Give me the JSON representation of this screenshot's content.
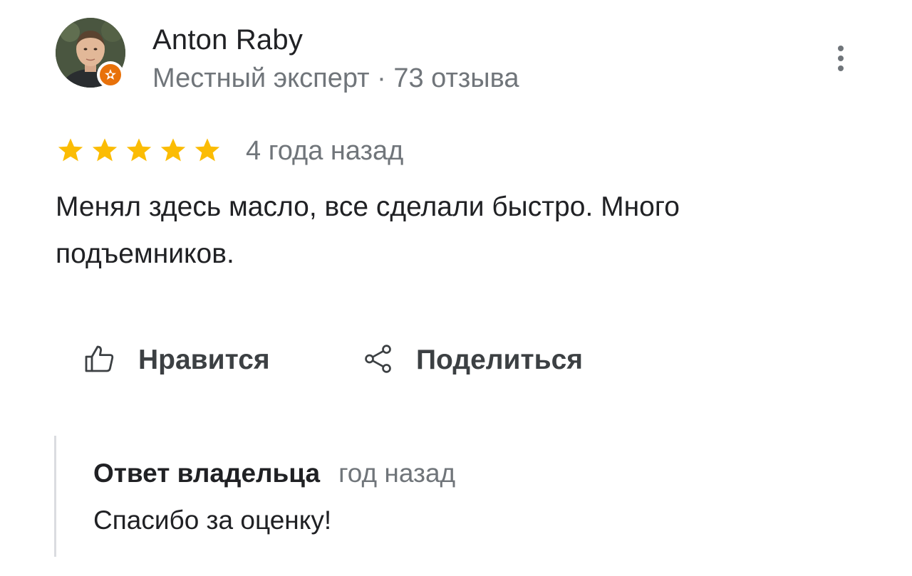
{
  "review": {
    "author": {
      "name": "Anton Raby",
      "meta": "Местный эксперт · 73 отзыва"
    },
    "rating": {
      "stars": 5,
      "max_stars": 5,
      "date": "4 года назад"
    },
    "text": "Менял здесь масло, все сделали быстро. Много подъемников.",
    "actions": {
      "like_label": "Нравится",
      "share_label": "Поделиться"
    },
    "owner_reply": {
      "title": "Ответ владельца",
      "date": "год назад",
      "text": "Спасибо за оценку!"
    }
  },
  "colors": {
    "star": "#fbbc04",
    "badge": "#e8710a",
    "secondary_text": "#70757a",
    "primary_text": "#202124",
    "reply_border": "#dadce0"
  },
  "icons": {
    "more": "more-vert-icon",
    "like": "thumb-up-icon",
    "share": "share-icon",
    "badge": "local-guide-badge-icon",
    "star": "star-icon"
  }
}
